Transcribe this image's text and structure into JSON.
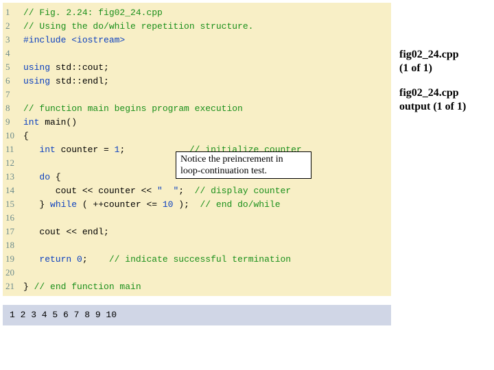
{
  "code": {
    "lines": [
      {
        "n": "1",
        "tokens": [
          [
            "c-comment",
            "// Fig. 2.24: fig02_24.cpp"
          ]
        ]
      },
      {
        "n": "2",
        "tokens": [
          [
            "c-comment",
            "// Using the do/while repetition structure."
          ]
        ]
      },
      {
        "n": "3",
        "tokens": [
          [
            "c-pp",
            "#include <iostream>"
          ]
        ]
      },
      {
        "n": "4",
        "tokens": []
      },
      {
        "n": "5",
        "tokens": [
          [
            "c-kw",
            "using "
          ],
          [
            "c-id",
            "std::cout;"
          ]
        ]
      },
      {
        "n": "6",
        "tokens": [
          [
            "c-kw",
            "using "
          ],
          [
            "c-id",
            "std::endl;"
          ]
        ]
      },
      {
        "n": "7",
        "tokens": []
      },
      {
        "n": "8",
        "tokens": [
          [
            "c-comment",
            "// function main begins program execution"
          ]
        ]
      },
      {
        "n": "9",
        "tokens": [
          [
            "c-kw",
            "int "
          ],
          [
            "c-id",
            "main()"
          ]
        ]
      },
      {
        "n": "10",
        "tokens": [
          [
            "c-id",
            "{"
          ]
        ]
      },
      {
        "n": "11",
        "tokens": [
          [
            "c-id",
            "   "
          ],
          [
            "c-kw",
            "int"
          ],
          [
            "c-id",
            " counter = "
          ],
          [
            "c-num",
            "1"
          ],
          [
            "c-id",
            ";            "
          ],
          [
            "c-comment",
            "// initialize counter"
          ]
        ]
      },
      {
        "n": "12",
        "tokens": []
      },
      {
        "n": "13",
        "tokens": [
          [
            "c-id",
            "   "
          ],
          [
            "c-kw",
            "do"
          ],
          [
            "c-id",
            " {"
          ]
        ]
      },
      {
        "n": "14",
        "tokens": [
          [
            "c-id",
            "      cout << counter << "
          ],
          [
            "c-num",
            "\"  \""
          ],
          [
            "c-id",
            ";  "
          ],
          [
            "c-comment",
            "// display counter"
          ]
        ]
      },
      {
        "n": "15",
        "tokens": [
          [
            "c-id",
            "   } "
          ],
          [
            "c-kw",
            "while"
          ],
          [
            "c-id",
            " ( ++counter <= "
          ],
          [
            "c-num",
            "10"
          ],
          [
            "c-id",
            " );  "
          ],
          [
            "c-comment",
            "// end do/while"
          ]
        ]
      },
      {
        "n": "16",
        "tokens": []
      },
      {
        "n": "17",
        "tokens": [
          [
            "c-id",
            "   cout << endl;"
          ]
        ]
      },
      {
        "n": "18",
        "tokens": []
      },
      {
        "n": "19",
        "tokens": [
          [
            "c-id",
            "   "
          ],
          [
            "c-kw",
            "return"
          ],
          [
            "c-id",
            " "
          ],
          [
            "c-num",
            "0"
          ],
          [
            "c-id",
            ";    "
          ],
          [
            "c-comment",
            "// indicate successful termination"
          ]
        ]
      },
      {
        "n": "20",
        "tokens": []
      },
      {
        "n": "21",
        "tokens": [
          [
            "c-id",
            "} "
          ],
          [
            "c-comment",
            "// end function main"
          ]
        ]
      }
    ]
  },
  "output": "1  2  3  4  5  6  7  8  9  10",
  "side": {
    "file1_line1": "fig02_24.cpp",
    "file1_line2": "(1 of 1)",
    "file2_line1": "fig02_24.cpp",
    "file2_line2": "output (1 of 1)"
  },
  "callout": {
    "line1": "Notice the preincrement in",
    "line2": "loop-continuation test."
  }
}
